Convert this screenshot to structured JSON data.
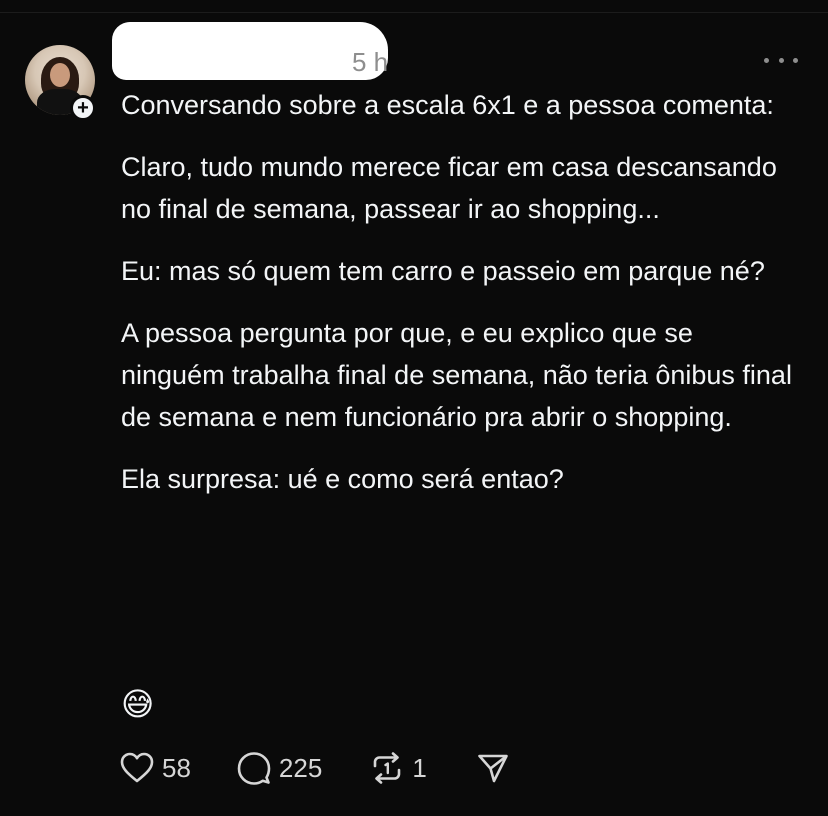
{
  "post": {
    "timestamp": "5 h",
    "paragraphs": [
      "Conversando sobre a escala 6x1 e a pessoa comenta:",
      "Claro, tudo mundo merece ficar em casa descansando no final de semana, passear ir ao shopping...",
      "Eu: mas só quem tem carro e passeio em parque né?",
      "A pessoa pergunta por que, e eu explico que se ninguém trabalha final de semana, não teria ônibus final de semana e nem funcionário pra abrir o shopping.",
      "Ela surpresa: ué e como será entao?"
    ],
    "emoji": "😅",
    "emoji_icon": "grinning-sweat-emoji"
  },
  "actions": {
    "likes": "58",
    "replies": "225",
    "reposts": "1"
  },
  "icons": {
    "follow": "plus-icon",
    "more": "more-horizontal-icon",
    "like": "heart-icon",
    "reply": "comment-bubble-icon",
    "repost": "repost-icon",
    "share": "send-icon"
  },
  "colors": {
    "background": "#0a0a0a",
    "text": "#f3f5f7",
    "muted": "#8e8e8e"
  }
}
